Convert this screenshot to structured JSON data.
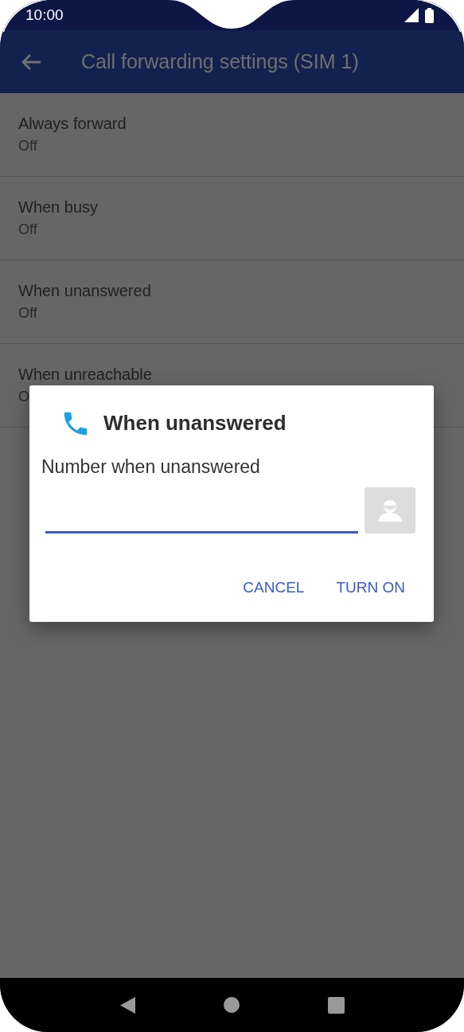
{
  "status_bar": {
    "time": "10:00"
  },
  "app_bar": {
    "title": "Call forwarding settings (SIM 1)"
  },
  "settings": [
    {
      "title": "Always forward",
      "value": "Off"
    },
    {
      "title": "When busy",
      "value": "Off"
    },
    {
      "title": "When unanswered",
      "value": "Off"
    },
    {
      "title": "When unreachable",
      "value": "O"
    }
  ],
  "dialog": {
    "title": "When unanswered",
    "label": "Number when unanswered",
    "buttons": [
      "CANCEL",
      "TURN ON"
    ]
  }
}
